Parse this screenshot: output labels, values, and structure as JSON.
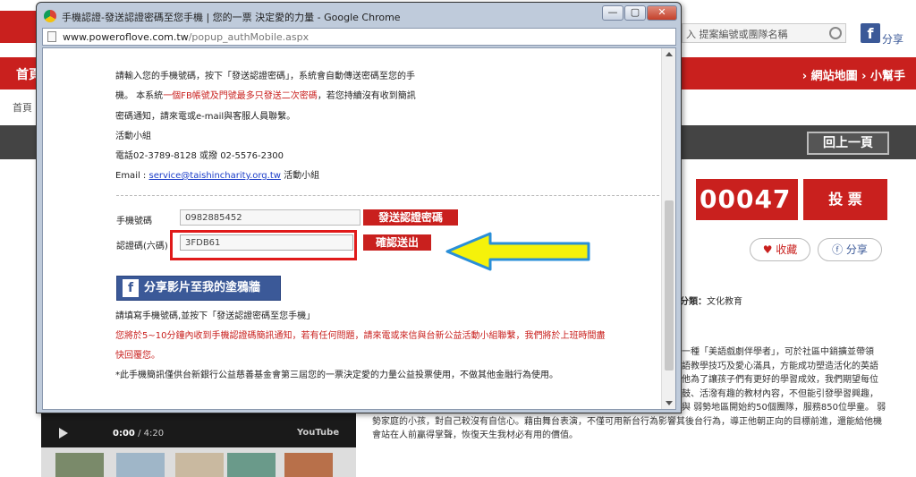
{
  "background": {
    "search_placeholder": "入 提案編號或團隊名稱",
    "share_label": "分享",
    "nav_home": "首頁",
    "nav_right": "› 網站地圖 › 小幫手",
    "breadcrumb": "首頁 ›",
    "back_button": "回上一頁",
    "vote_count": "00047",
    "vote_unit": "票",
    "vote_button": "投 票",
    "favorite_button": "收藏",
    "share_button": "分享",
    "category_label": "分類：",
    "category_value": "文化教育",
    "description_lines": [
      "一種「美語戲劇伴學者」，可於社區中銷擴並帶領",
      "語教學技巧及愛心滿具，方能成功塑造活化的英語",
      "他為了讓孩子們有更好的學習成效，我們期望每位",
      "鼓、活潑有趣的教材內容，不但能引發學習興趣，",
      "與 弱勢地區開始約50個團隊，服務850位學童。 弱",
      "勢家庭的小孩，對自己較沒有自信心。藉由舞台表演，不僅可用新台行為影響其後台行為，導正他朝正向的目標前進，還能給他機",
      "會站在人前贏得掌聲，恢復天生我材必有用的價值。"
    ],
    "video_time_current": "0:00",
    "video_time_total": "/ 4:20",
    "video_brand": "YouTube"
  },
  "window": {
    "title": "手機認證-發送認證密碼至您手機 | 您的一票 決定愛的力量 - Google Chrome",
    "url_host": "www.poweroflove.com.tw",
    "url_path": "/popup_authMobile.aspx",
    "min_label": "—",
    "max_label": "▢",
    "close_label": "✕"
  },
  "popup": {
    "intro_line1": "請輸入您的手機號碼，按下「發送認證密碼」，系統會自動傳送密碼至您的手",
    "intro_line2_a": "機。 本系統",
    "intro_line2_red": "一個FB帳號及門號最多只發送二次密碼",
    "intro_line2_b": "，若您持續沒有收到簡訊",
    "intro_line3": "密碼通知，請來電或e-mail與客服人員聯繫。",
    "team": "活動小組",
    "phone": "電話02-3789-8128 或撥 02-5576-2300",
    "email_prefix": "Email : ",
    "email_address": "service@taishincharity.org.tw",
    "email_suffix": " 活動小組",
    "mobile_label": "手機號碼",
    "mobile_value": "0982885452",
    "send_button": "發送認證密碼",
    "code_label": "認證碼(六碼)",
    "code_value": "3FDB61",
    "confirm_button": "確認送出",
    "fb_share_button": "分享影片至我的塗鴉牆",
    "hint_line": "請填寫手機號碼,並按下「發送認證密碼至您手機」",
    "notice_line1": "您將於5~10分鐘內收到手機認證碼簡訊通知，若有任何問題，請來電或來信與台新公益活動小組聯繫，我們將於上班時間盡",
    "notice_line2": "快回覆您。",
    "footnote": "*此手機簡訊僅供台新銀行公益慈善基金會第三屆您的一票決定愛的力量公益投票使用，不做其他金融行為使用。"
  },
  "colors": {
    "brand_red": "#c9201e",
    "facebook_blue": "#3b5998",
    "arrow_fill": "#f5f20a",
    "arrow_stroke": "#2a8fd8"
  }
}
